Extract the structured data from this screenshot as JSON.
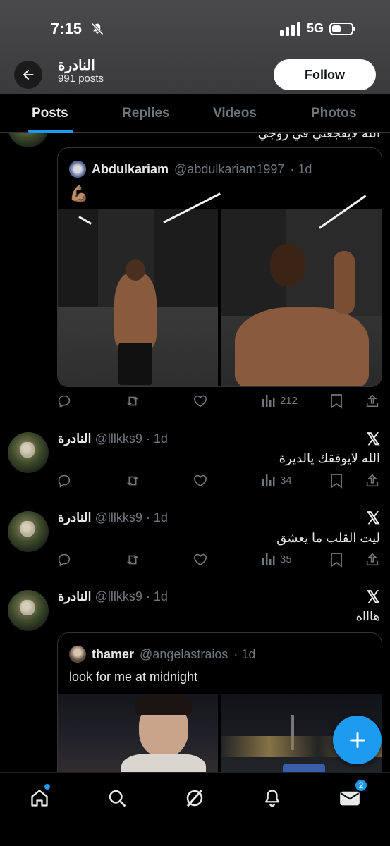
{
  "status_bar": {
    "time": "7:15",
    "network": "5G"
  },
  "header": {
    "title": "النادرة",
    "post_count": "991 posts",
    "follow_label": "Follow"
  },
  "tabs": [
    {
      "label": "Posts"
    },
    {
      "label": "Replies"
    },
    {
      "label": "Videos"
    },
    {
      "label": "Photos"
    }
  ],
  "posts": [
    {
      "partial_text": "الله لايفجعني في زوجي",
      "quote": {
        "name": "Abdulkariam",
        "handle": "@abdulkariam1997",
        "time": "· 1d",
        "text": "💪🏽"
      },
      "views": "212"
    },
    {
      "name": "النادرة",
      "handle": "@lllkks9",
      "time": "· 1d",
      "text": "الله لايوفقك يالديرة",
      "views": "34"
    },
    {
      "name": "النادرة",
      "handle": "@lllkks9",
      "time": "· 1d",
      "text": "ليت القلب ما يعشق",
      "views": "35"
    },
    {
      "name": "النادرة",
      "handle": "@lllkks9",
      "time": "· 1d",
      "text": "هاااه",
      "quote": {
        "name": "thamer",
        "handle": "@angelastraios",
        "time": "· 1d",
        "text": "look for me at midnight"
      }
    }
  ],
  "bottom_nav": {
    "messages_badge": "2"
  },
  "colors": {
    "accent": "#1d9bf0",
    "background": "#000000",
    "muted": "#71767b"
  }
}
